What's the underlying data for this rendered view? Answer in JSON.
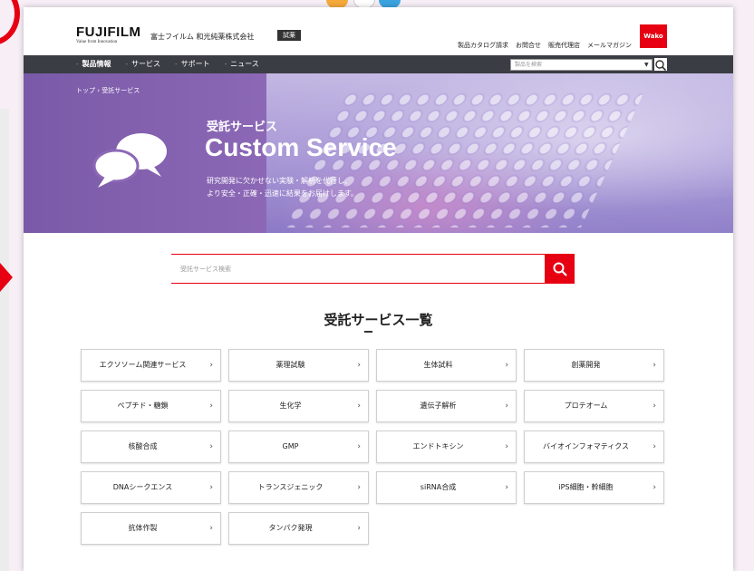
{
  "colors": {
    "brand_red": "#e60012",
    "nav_bg": "#3a3d44",
    "hero_purple": "#8c68b6"
  },
  "header": {
    "logo": "FUJIFILM",
    "logo_tagline": "Value from Innovation",
    "company": "富士フイルム 和光純薬株式会社",
    "trial_badge": "試薬",
    "util_links": [
      "製品カタログ請求",
      "お問合せ",
      "販売代理店",
      "メールマガジン"
    ],
    "wako_badge": "Wako"
  },
  "nav": {
    "items": [
      "製品情報",
      "サービス",
      "サポート",
      "ニュース"
    ],
    "search_placeholder": "製品を検索",
    "search_icon": "search-icon"
  },
  "hero": {
    "breadcrumb": "トップ › 受託サービス",
    "title_jp": "受託サービス",
    "title_en": "Custom Service",
    "desc_line1": "研究開発に欠かせない実験・解析を代行し、",
    "desc_line2": "より安全・正確・迅速に結果をお届けします。",
    "icon": "chat-bubbles-icon"
  },
  "service_search": {
    "placeholder": "受託サービス検索",
    "icon": "search-icon"
  },
  "list": {
    "title": "受託サービス一覧",
    "items": [
      "エクソソーム関連サービス",
      "薬理試験",
      "生体試料",
      "創薬開発",
      "ペプチド・糖鎖",
      "生化学",
      "遺伝子解析",
      "プロテオーム",
      "核酸合成",
      "GMP",
      "エンドトキシン",
      "バイオインフォマティクス",
      "DNAシークエンス",
      "トランスジェニック",
      "siRNA合成",
      "iPS細胞・幹細胞",
      "抗体作製",
      "タンパク発現"
    ],
    "chevron": "›"
  }
}
